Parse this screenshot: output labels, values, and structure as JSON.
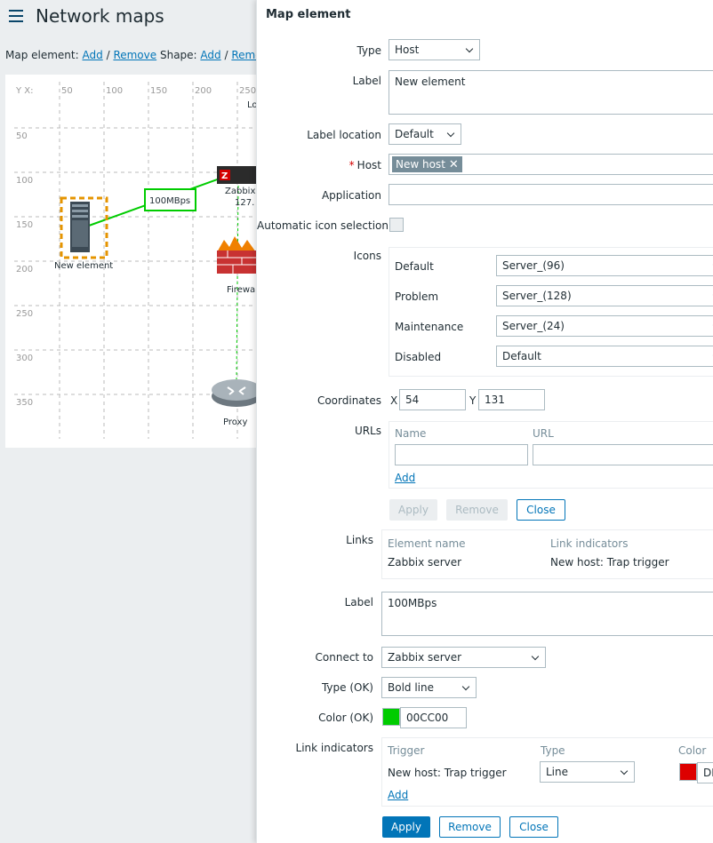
{
  "header": {
    "title": "Network maps"
  },
  "toolbar": {
    "map_element_label": "Map element:",
    "add": "Add",
    "sep1": "/",
    "remove": "Remove",
    "shape_label": "Shape:",
    "shape_add": "Add",
    "sep2": "/",
    "shape_remove": "Remove"
  },
  "map": {
    "axis_corner": "Y X:",
    "x_ticks": [
      "50",
      "100",
      "150",
      "200",
      "250"
    ],
    "y_ticks": [
      "50",
      "100",
      "150",
      "200",
      "250",
      "300",
      "350"
    ],
    "link_label": "100MBps",
    "nodes": {
      "new_element": "New element",
      "zabbix": "Zabbix",
      "zabbix_ip": "127.",
      "firewall": "Firewa",
      "proxy": "Proxy",
      "top_label": "Lo"
    },
    "colors": {
      "link": "#00cc00",
      "selection": "#e59400"
    }
  },
  "dialog": {
    "title": "Map element",
    "type_label": "Type",
    "type_value": "Host",
    "label_label": "Label",
    "label_value": "New element",
    "label_location_label": "Label location",
    "label_location_value": "Default",
    "host_label": "Host",
    "host_tag": "New host",
    "application_label": "Application",
    "application_value": "",
    "auto_icon_label": "Automatic icon selection",
    "icons_label": "Icons",
    "icons": [
      {
        "label": "Default",
        "value": "Server_(96)"
      },
      {
        "label": "Problem",
        "value": "Server_(128)"
      },
      {
        "label": "Maintenance",
        "value": "Server_(24)"
      },
      {
        "label": "Disabled",
        "value": "Default"
      }
    ],
    "coordinates_label": "Coordinates",
    "x_label": "X",
    "x_value": "54",
    "y_label": "Y",
    "y_value": "131",
    "urls_label": "URLs",
    "urls_name_header": "Name",
    "urls_url_header": "URL",
    "urls_add": "Add",
    "apply": "Apply",
    "remove": "Remove",
    "close": "Close",
    "links_label": "Links",
    "links_headers": {
      "element": "Element name",
      "indicators": "Link indicators"
    },
    "links_row": {
      "element": "Zabbix server",
      "indicators": "New host: Trap trigger"
    },
    "link_label_label": "Label",
    "link_label_value": "100MBps",
    "connect_to_label": "Connect to",
    "connect_to_value": "Zabbix server",
    "type_ok_label": "Type (OK)",
    "type_ok_value": "Bold line",
    "color_ok_label": "Color (OK)",
    "color_ok_value": "00CC00",
    "color_ok_swatch": "#00cc00",
    "link_indicators_label": "Link indicators",
    "li_headers": {
      "trigger": "Trigger",
      "type": "Type",
      "color": "Color"
    },
    "li_row": {
      "trigger": "New host: Trap trigger",
      "type": "Line",
      "color": "DD",
      "swatch": "#dd0000"
    },
    "li_add": "Add",
    "bottom_apply": "Apply",
    "bottom_remove": "Remove",
    "bottom_close": "Close"
  }
}
